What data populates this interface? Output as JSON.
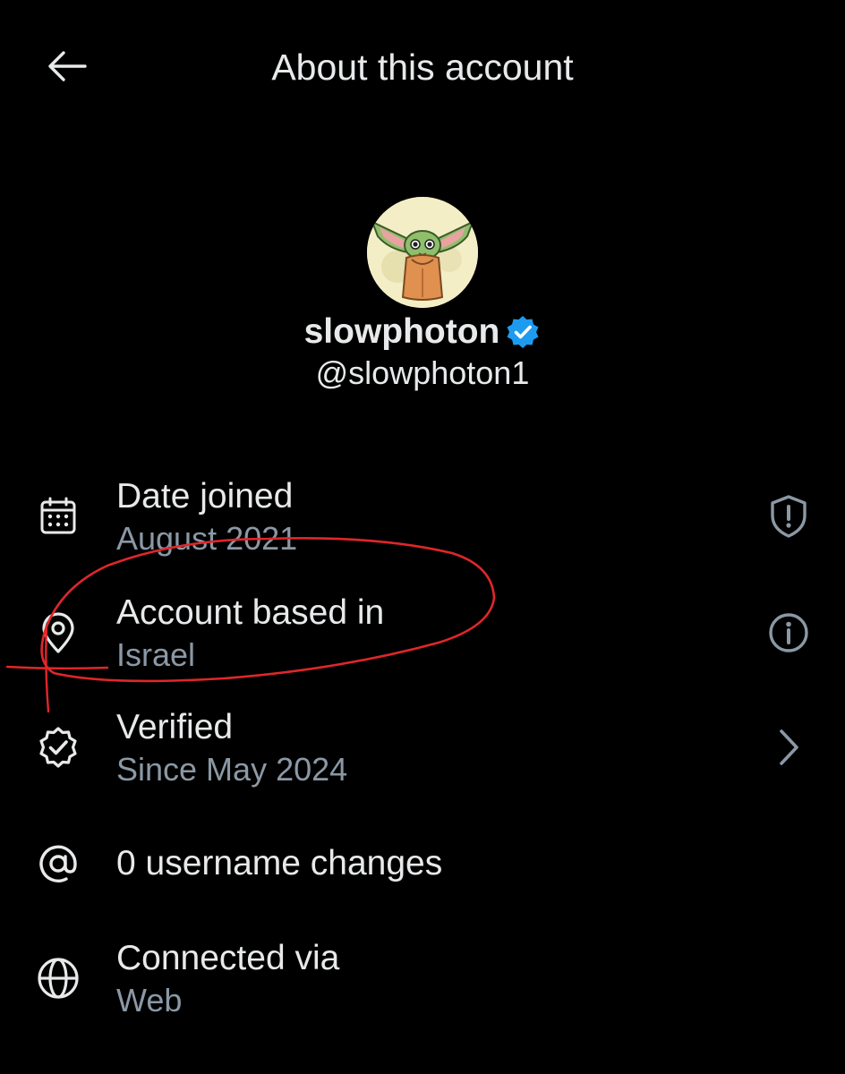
{
  "header": {
    "title": "About this account",
    "back_icon": "arrow-left-icon"
  },
  "profile": {
    "display_name": "slowphoton",
    "handle": "@slowphoton1",
    "verified": true,
    "badge_color": "#1d9bf0"
  },
  "rows": [
    {
      "icon": "calendar-icon",
      "title": "Date joined",
      "subtitle": "August 2021",
      "action_icon": "shield-alert-icon"
    },
    {
      "icon": "location-pin-icon",
      "title": "Account based in",
      "subtitle": "Israel",
      "action_icon": "info-icon"
    },
    {
      "icon": "verified-check-icon",
      "title": "Verified",
      "subtitle": "Since May 2024",
      "action_icon": "chevron-right-icon"
    },
    {
      "icon": "at-sign-icon",
      "title": "0 username changes"
    },
    {
      "icon": "globe-icon",
      "title": "Connected via",
      "subtitle": "Web"
    }
  ],
  "colors": {
    "background": "#000000",
    "primary_text": "#e7e9ea",
    "secondary_text": "#8b98a5",
    "annotation_red": "#e0262b"
  }
}
